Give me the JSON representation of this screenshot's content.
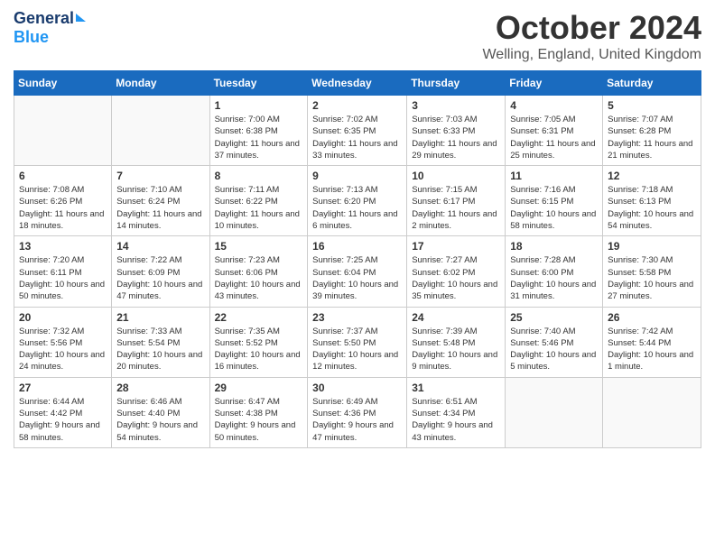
{
  "header": {
    "logo_general": "General",
    "logo_blue": "Blue",
    "month_title": "October 2024",
    "location": "Welling, England, United Kingdom"
  },
  "days_of_week": [
    "Sunday",
    "Monday",
    "Tuesday",
    "Wednesday",
    "Thursday",
    "Friday",
    "Saturday"
  ],
  "weeks": [
    [
      {
        "day": "",
        "info": ""
      },
      {
        "day": "",
        "info": ""
      },
      {
        "day": "1",
        "info": "Sunrise: 7:00 AM\nSunset: 6:38 PM\nDaylight: 11 hours and 37 minutes."
      },
      {
        "day": "2",
        "info": "Sunrise: 7:02 AM\nSunset: 6:35 PM\nDaylight: 11 hours and 33 minutes."
      },
      {
        "day": "3",
        "info": "Sunrise: 7:03 AM\nSunset: 6:33 PM\nDaylight: 11 hours and 29 minutes."
      },
      {
        "day": "4",
        "info": "Sunrise: 7:05 AM\nSunset: 6:31 PM\nDaylight: 11 hours and 25 minutes."
      },
      {
        "day": "5",
        "info": "Sunrise: 7:07 AM\nSunset: 6:28 PM\nDaylight: 11 hours and 21 minutes."
      }
    ],
    [
      {
        "day": "6",
        "info": "Sunrise: 7:08 AM\nSunset: 6:26 PM\nDaylight: 11 hours and 18 minutes."
      },
      {
        "day": "7",
        "info": "Sunrise: 7:10 AM\nSunset: 6:24 PM\nDaylight: 11 hours and 14 minutes."
      },
      {
        "day": "8",
        "info": "Sunrise: 7:11 AM\nSunset: 6:22 PM\nDaylight: 11 hours and 10 minutes."
      },
      {
        "day": "9",
        "info": "Sunrise: 7:13 AM\nSunset: 6:20 PM\nDaylight: 11 hours and 6 minutes."
      },
      {
        "day": "10",
        "info": "Sunrise: 7:15 AM\nSunset: 6:17 PM\nDaylight: 11 hours and 2 minutes."
      },
      {
        "day": "11",
        "info": "Sunrise: 7:16 AM\nSunset: 6:15 PM\nDaylight: 10 hours and 58 minutes."
      },
      {
        "day": "12",
        "info": "Sunrise: 7:18 AM\nSunset: 6:13 PM\nDaylight: 10 hours and 54 minutes."
      }
    ],
    [
      {
        "day": "13",
        "info": "Sunrise: 7:20 AM\nSunset: 6:11 PM\nDaylight: 10 hours and 50 minutes."
      },
      {
        "day": "14",
        "info": "Sunrise: 7:22 AM\nSunset: 6:09 PM\nDaylight: 10 hours and 47 minutes."
      },
      {
        "day": "15",
        "info": "Sunrise: 7:23 AM\nSunset: 6:06 PM\nDaylight: 10 hours and 43 minutes."
      },
      {
        "day": "16",
        "info": "Sunrise: 7:25 AM\nSunset: 6:04 PM\nDaylight: 10 hours and 39 minutes."
      },
      {
        "day": "17",
        "info": "Sunrise: 7:27 AM\nSunset: 6:02 PM\nDaylight: 10 hours and 35 minutes."
      },
      {
        "day": "18",
        "info": "Sunrise: 7:28 AM\nSunset: 6:00 PM\nDaylight: 10 hours and 31 minutes."
      },
      {
        "day": "19",
        "info": "Sunrise: 7:30 AM\nSunset: 5:58 PM\nDaylight: 10 hours and 27 minutes."
      }
    ],
    [
      {
        "day": "20",
        "info": "Sunrise: 7:32 AM\nSunset: 5:56 PM\nDaylight: 10 hours and 24 minutes."
      },
      {
        "day": "21",
        "info": "Sunrise: 7:33 AM\nSunset: 5:54 PM\nDaylight: 10 hours and 20 minutes."
      },
      {
        "day": "22",
        "info": "Sunrise: 7:35 AM\nSunset: 5:52 PM\nDaylight: 10 hours and 16 minutes."
      },
      {
        "day": "23",
        "info": "Sunrise: 7:37 AM\nSunset: 5:50 PM\nDaylight: 10 hours and 12 minutes."
      },
      {
        "day": "24",
        "info": "Sunrise: 7:39 AM\nSunset: 5:48 PM\nDaylight: 10 hours and 9 minutes."
      },
      {
        "day": "25",
        "info": "Sunrise: 7:40 AM\nSunset: 5:46 PM\nDaylight: 10 hours and 5 minutes."
      },
      {
        "day": "26",
        "info": "Sunrise: 7:42 AM\nSunset: 5:44 PM\nDaylight: 10 hours and 1 minute."
      }
    ],
    [
      {
        "day": "27",
        "info": "Sunrise: 6:44 AM\nSunset: 4:42 PM\nDaylight: 9 hours and 58 minutes."
      },
      {
        "day": "28",
        "info": "Sunrise: 6:46 AM\nSunset: 4:40 PM\nDaylight: 9 hours and 54 minutes."
      },
      {
        "day": "29",
        "info": "Sunrise: 6:47 AM\nSunset: 4:38 PM\nDaylight: 9 hours and 50 minutes."
      },
      {
        "day": "30",
        "info": "Sunrise: 6:49 AM\nSunset: 4:36 PM\nDaylight: 9 hours and 47 minutes."
      },
      {
        "day": "31",
        "info": "Sunrise: 6:51 AM\nSunset: 4:34 PM\nDaylight: 9 hours and 43 minutes."
      },
      {
        "day": "",
        "info": ""
      },
      {
        "day": "",
        "info": ""
      }
    ]
  ]
}
